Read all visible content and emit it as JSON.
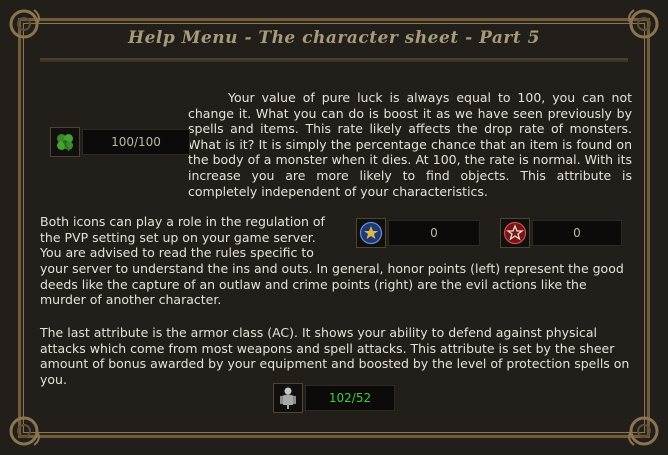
{
  "title": "Help Menu - The character sheet - Part 5",
  "paragraphs": {
    "luck": "Your value of pure luck is always equal to 100, you can not change it. What you can do is boost it as we have seen previously by spells and items. This rate likely affects the drop rate of monsters. What is it? It is simply the percentage chance that an item is found on the body of a monster when it dies. At 100, the rate is normal. With its increase you are more likely to find objects. This attribute is completely independent of your characteristics.",
    "pvp_intro": "Both icons can play a role in the regulation of the PVP setting set up on your game server. You are advised to read the rules specific to",
    "pvp_rest": "your server to understand the ins and outs. In general, honor points (left) represent the good deeds like the capture of an outlaw and crime points (right) are the evil actions like the murder of another character.",
    "armor": "The last attribute is the armor class (AC). It shows your ability to defend against physical attacks which come from most weapons and spell attacks. This attribute is set by the sheer amount of bonus awarded by your equipment and boosted by the level of protection spells on you."
  },
  "stats": {
    "luck": {
      "icon": "four-leaf-clover-icon",
      "value": "100/100"
    },
    "honor": {
      "icon": "honor-star-icon",
      "value": "0"
    },
    "crime": {
      "icon": "crime-pentagram-icon",
      "value": "0"
    },
    "armor": {
      "icon": "armor-knight-icon",
      "value": "102/52"
    }
  },
  "colors": {
    "background": "#221f1b",
    "title": "#a89a7a",
    "text": "#e6e2d8",
    "armor_value": "#3fcc3f"
  }
}
